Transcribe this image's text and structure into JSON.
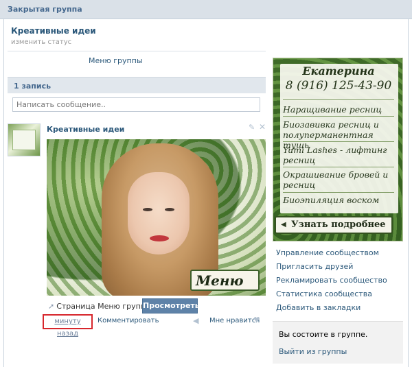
{
  "topbar": {
    "title": "Закрытая группа"
  },
  "group": {
    "name": "Креативные идеи",
    "status_link": "изменить статус",
    "menu_link": "Меню группы"
  },
  "posts": {
    "count_label": "1 запись",
    "compose_placeholder": "Написать сообщение.."
  },
  "post": {
    "author": "Креативные идеи",
    "image_banner": "Меню",
    "page_link": "Страница Меню группы",
    "view_button": "Просмотреть",
    "time": "минуту назад",
    "comment": "Комментировать",
    "like": "Мне нравится"
  },
  "ad": {
    "name": "Екатерина",
    "phone": "8 (916) 125-43-90",
    "items": [
      "Наращивание ресниц",
      "Биозавивка ресниц и полуперманентная тушь",
      "Yumi Lashes - лифтинг ресниц",
      "Окрашивание бровей и ресниц",
      "Биоэпиляция воском"
    ],
    "button": "Узнать подробнее"
  },
  "sidebar_links": [
    "Управление сообществом",
    "Пригласить друзей",
    "Рекламировать сообщество",
    "Статистика сообщества",
    "Добавить в закладки"
  ],
  "membership": {
    "text": "Вы состоите в группе.",
    "leave": "Выйти из группы"
  },
  "colors": {
    "link": "#2b587a",
    "header_bg": "#dae1e8",
    "button_bg": "#5e82a8",
    "highlight_box": "#d7262c"
  }
}
